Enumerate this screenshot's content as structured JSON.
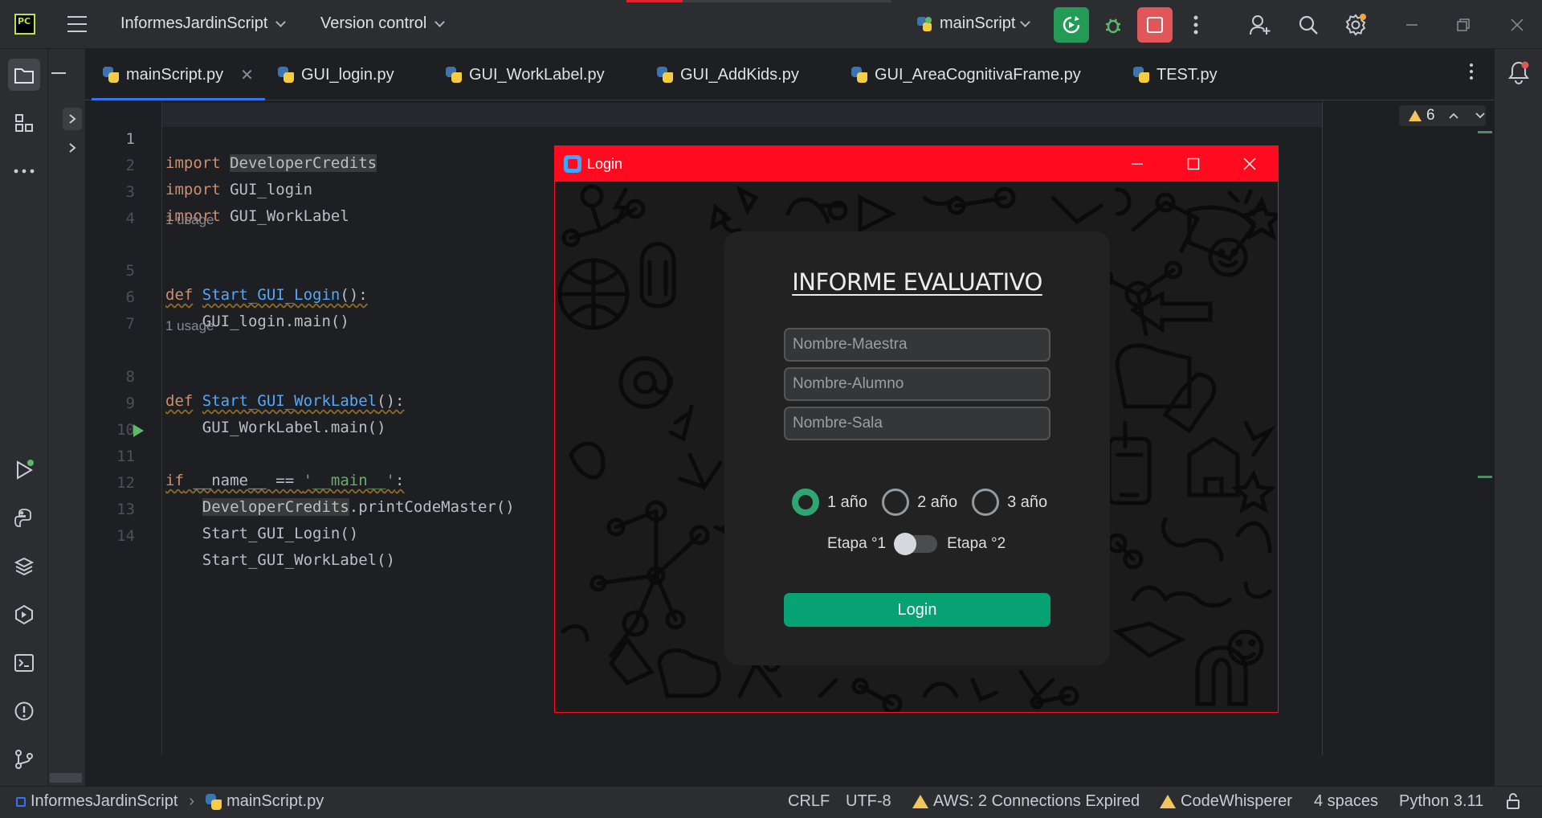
{
  "ide": {
    "logo_text": "PC",
    "project_name": "InformesJardinScript",
    "vcs_label": "Version control",
    "run_config": "mainScript"
  },
  "tabs": [
    {
      "label": "mainScript.py",
      "active": true
    },
    {
      "label": "GUI_login.py",
      "active": false
    },
    {
      "label": "GUI_WorkLabel.py",
      "active": false
    },
    {
      "label": "GUI_AddKids.py",
      "active": false
    },
    {
      "label": "GUI_AreaCognitivaFrame.py",
      "active": false
    },
    {
      "label": "TEST.py",
      "active": false
    }
  ],
  "editor": {
    "warnings_count": "6",
    "usage_hint": "1 usage",
    "line_numbers": [
      "1",
      "2",
      "3",
      "4",
      "5",
      "6",
      "7",
      "8",
      "9",
      "10",
      "11",
      "12",
      "13",
      "14"
    ],
    "lines": {
      "l1_kw": "import",
      "l1_rest": "DeveloperCredits",
      "l2_kw": "import",
      "l2_rest": " GUI_login",
      "l3_kw": "import",
      "l3_rest": " GUI_WorkLabel",
      "l5_kw": "def",
      "l5_fn": "Start_GUI_Login",
      "l5_rest": "():",
      "l6": "    GUI_login.main()",
      "l8_kw": "def",
      "l8_fn": "Start_GUI_WorkLabel",
      "l8_rest": "():",
      "l9": "    GUI_WorkLabel.main()",
      "l11_kw": "if",
      "l11_mid": " __name__ == ",
      "l11_str": "'__main__'",
      "l11_end": ":",
      "l12_a": "DeveloperCredits",
      "l12_b": ".printCodeMaster()",
      "l13": "    Start_GUI_Login()",
      "l14": "    Start_GUI_WorkLabel()"
    }
  },
  "statusbar": {
    "breadcrumb_project": "InformesJardinScript",
    "breadcrumb_file": "mainScript.py",
    "line_sep": "CRLF",
    "encoding": "UTF-8",
    "aws": "AWS: 2 Connections Expired",
    "codewhisperer": "CodeWhisperer",
    "indent": "4 spaces",
    "interpreter": "Python 3.11"
  },
  "login_window": {
    "title": "Login",
    "heading": "INFORME EVALUATIVO",
    "placeholders": {
      "maestra": "Nombre-Maestra",
      "alumno": "Nombre-Alumno",
      "sala": "Nombre-Sala"
    },
    "radios": [
      {
        "label": "1 año",
        "selected": true
      },
      {
        "label": "2 año",
        "selected": false
      },
      {
        "label": "3 año",
        "selected": false
      }
    ],
    "switch_left": "Etapa °1",
    "switch_right": "Etapa °2",
    "login_button": "Login",
    "colors": {
      "titlebar": "#ff0a1e",
      "accent": "#06a273"
    }
  }
}
